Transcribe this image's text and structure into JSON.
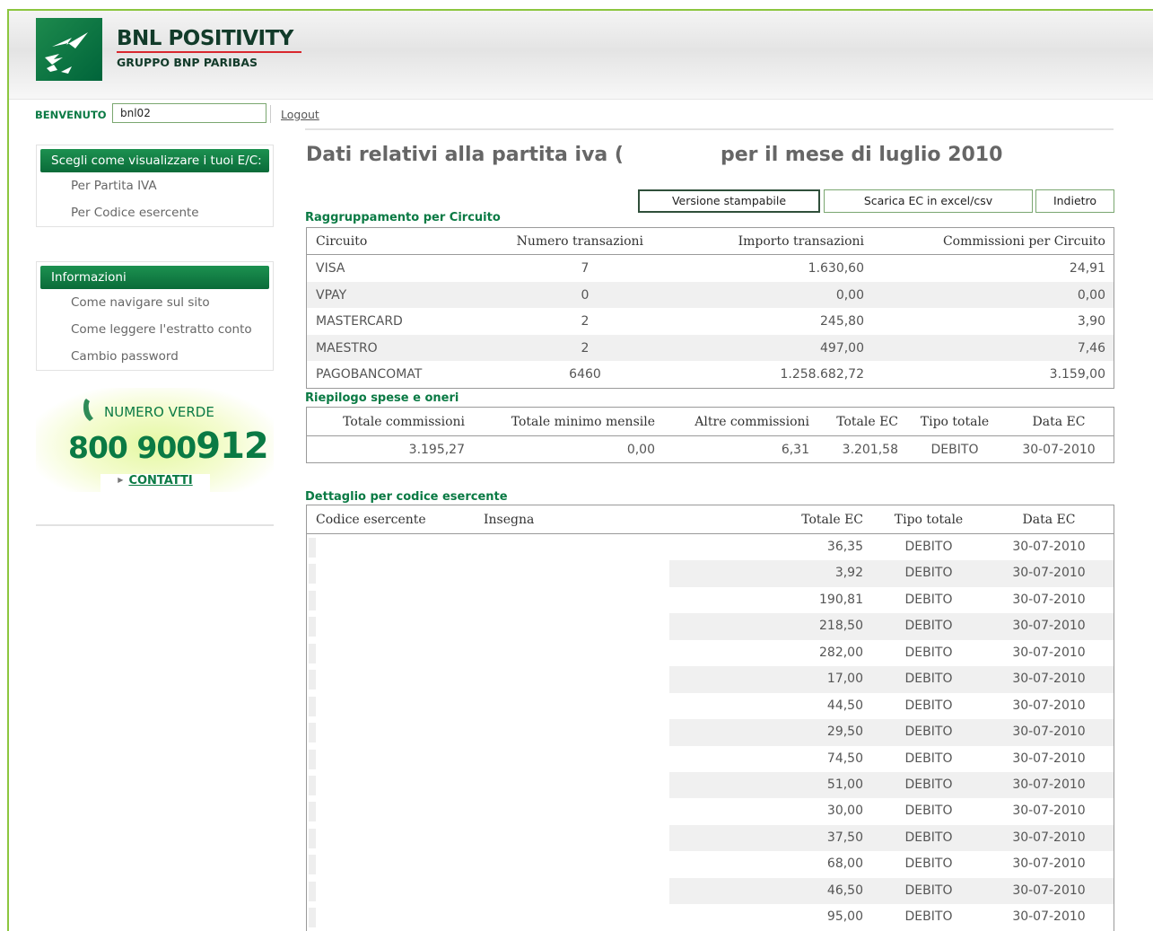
{
  "header": {
    "brand_title": "BNL POSITIVITY",
    "brand_subtitle": "GRUPPO BNP PARIBAS"
  },
  "welcome": {
    "label": "BENVENUTO",
    "username": "bnl02",
    "logout": "Logout"
  },
  "sidebar": {
    "view_box": {
      "title": "Scegli come visualizzare i tuoi E/C:",
      "items": [
        "Per Partita IVA",
        "Per Codice esercente"
      ]
    },
    "info_box": {
      "title": "Informazioni",
      "items": [
        "Come navigare sul sito",
        "Come leggere l'estratto conto",
        "Cambio password"
      ]
    },
    "promo": {
      "label": "NUMERO VERDE",
      "number_prefix": "800 900",
      "number_suffix": "912",
      "contact": "CONTATTI"
    }
  },
  "main": {
    "title_left": "Dati relativi alla partita iva (",
    "title_right": "per il mese di luglio 2010",
    "buttons": {
      "print": "Versione stampabile",
      "download": "Scarica EC in excel/csv",
      "back": "Indietro"
    },
    "circuit": {
      "label": "Raggruppamento per Circuito",
      "headers": [
        "Circuito",
        "Numero transazioni",
        "Importo transazioni",
        "Commissioni per Circuito"
      ],
      "rows": [
        [
          "VISA",
          "7",
          "1.630,60",
          "24,91"
        ],
        [
          "VPAY",
          "0",
          "0,00",
          "0,00"
        ],
        [
          "MASTERCARD",
          "2",
          "245,80",
          "3,90"
        ],
        [
          "MAESTRO",
          "2",
          "497,00",
          "7,46"
        ],
        [
          "PAGOBANCOMAT",
          "6460",
          "1.258.682,72",
          "3.159,00"
        ]
      ]
    },
    "summary": {
      "label": "Riepilogo spese e oneri",
      "headers": [
        "Totale commissioni",
        "Totale minimo mensile",
        "Altre commissioni",
        "Totale EC",
        "Tipo totale",
        "Data EC"
      ],
      "row": [
        "3.195,27",
        "0,00",
        "6,31",
        "3.201,58",
        "DEBITO",
        "30-07-2010"
      ]
    },
    "detail": {
      "label": "Dettaglio per codice esercente",
      "headers": [
        "Codice esercente",
        "Insegna",
        "Totale EC",
        "Tipo totale",
        "Data EC"
      ],
      "rows": [
        [
          "36,35",
          "DEBITO",
          "30-07-2010"
        ],
        [
          "3,92",
          "DEBITO",
          "30-07-2010"
        ],
        [
          "190,81",
          "DEBITO",
          "30-07-2010"
        ],
        [
          "218,50",
          "DEBITO",
          "30-07-2010"
        ],
        [
          "282,00",
          "DEBITO",
          "30-07-2010"
        ],
        [
          "17,00",
          "DEBITO",
          "30-07-2010"
        ],
        [
          "44,50",
          "DEBITO",
          "30-07-2010"
        ],
        [
          "29,50",
          "DEBITO",
          "30-07-2010"
        ],
        [
          "74,50",
          "DEBITO",
          "30-07-2010"
        ],
        [
          "51,00",
          "DEBITO",
          "30-07-2010"
        ],
        [
          "30,00",
          "DEBITO",
          "30-07-2010"
        ],
        [
          "37,50",
          "DEBITO",
          "30-07-2010"
        ],
        [
          "68,00",
          "DEBITO",
          "30-07-2010"
        ],
        [
          "46,50",
          "DEBITO",
          "30-07-2010"
        ],
        [
          "95,00",
          "DEBITO",
          "30-07-2010"
        ]
      ]
    }
  }
}
